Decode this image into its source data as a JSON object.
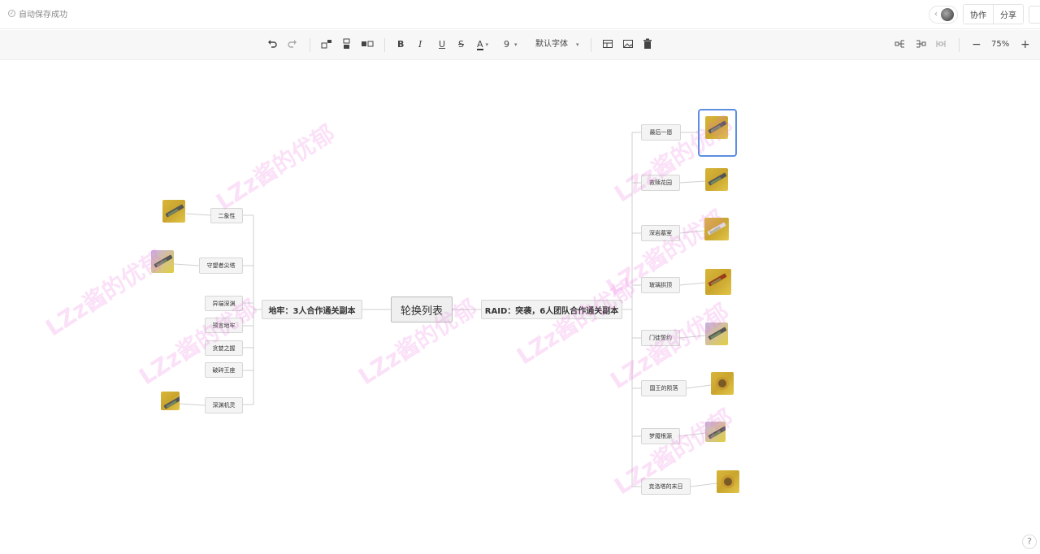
{
  "status": {
    "text": "自动保存成功"
  },
  "header": {
    "collab_label": "协作",
    "share_label": "分享"
  },
  "toolbar": {
    "font_size": "9",
    "font_family": "默认字体",
    "zoom": "75%"
  },
  "mindmap": {
    "root": "轮换列表",
    "left_branch": {
      "label": "地牢：3人合作通关副本",
      "children": [
        "二象性",
        "守望者尖塔",
        "异端深渊",
        "预言地牢",
        "贪婪之握",
        "破碎王座",
        "深渊机灵"
      ]
    },
    "right_branch": {
      "label": "RAID：突袭，6人团队合作通关副本",
      "children": [
        "最后一愿",
        "救赎花园",
        "深岩墓室",
        "玻璃拱顶",
        "门徒誓约",
        "国王的陨落",
        "梦魇根源",
        "克洛塔的末日"
      ]
    }
  },
  "watermark": "LZz酱的优郁"
}
